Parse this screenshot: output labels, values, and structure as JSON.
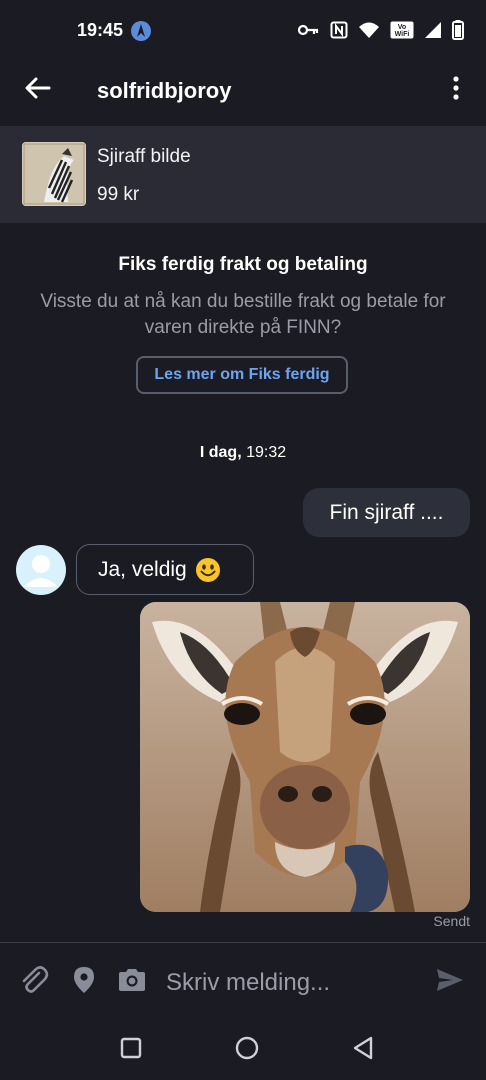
{
  "status_bar": {
    "time": "19:45",
    "icons": [
      "app-notification-icon",
      "key-icon",
      "nfc-icon",
      "wifi-icon",
      "vowifi-icon",
      "signal-icon",
      "battery-icon"
    ],
    "vowifi_top": "Vo",
    "vowifi_bottom": "WiFi"
  },
  "header": {
    "title": "solfridbjoroy",
    "back_icon": "back-arrow-icon",
    "menu_icon": "more-vertical-icon"
  },
  "product": {
    "title": "Sjiraff bilde",
    "price": "99 kr"
  },
  "info": {
    "title": "Fiks ferdig frakt og betaling",
    "text": "Visste du at nå kan du bestille frakt og betale for varen direkte på FINN?",
    "button_label": "Les mer om Fiks ferdig"
  },
  "date": {
    "day": "I dag,",
    "time": "19:32"
  },
  "messages": {
    "outgoing_text": "Fin sjiraff ....",
    "incoming_text": "Ja, veldig",
    "sent_status": "Sendt"
  },
  "composer": {
    "placeholder": "Skriv melding...",
    "icons": [
      "attachment-icon",
      "location-icon",
      "camera-icon",
      "send-icon"
    ]
  },
  "nav_bar": {
    "icons": [
      "recents-square-icon",
      "home-circle-icon",
      "back-triangle-icon"
    ]
  },
  "colors": {
    "background": "#1b1b23",
    "card": "#2a2b35",
    "link": "#6ea3f0",
    "muted_text": "#9b9ca6"
  }
}
